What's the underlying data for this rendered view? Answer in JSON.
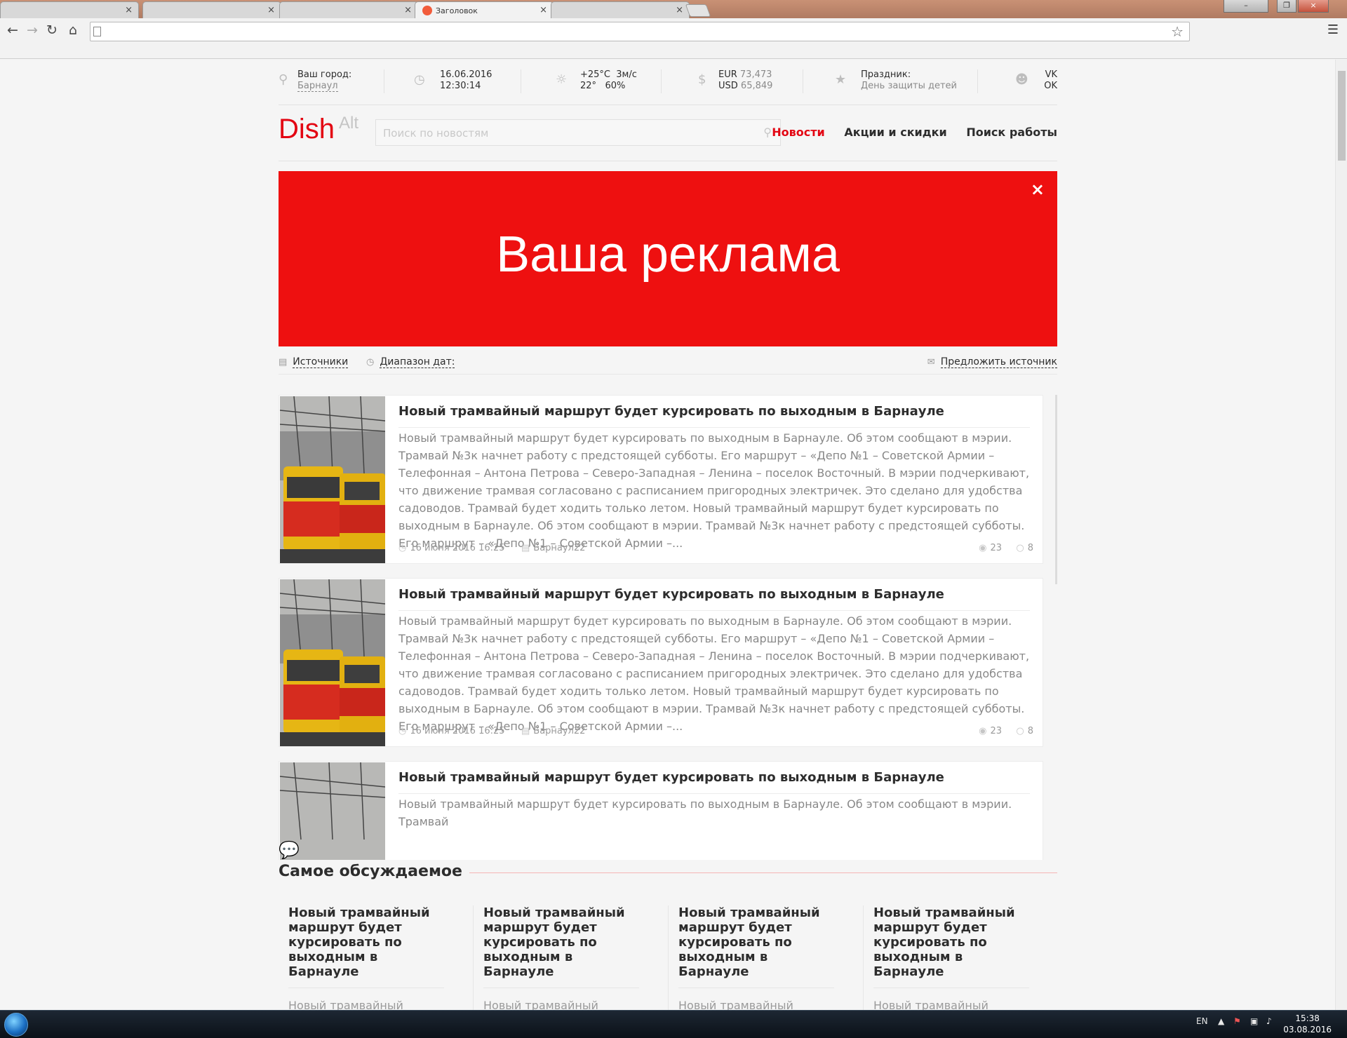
{
  "browser": {
    "tabs": [
      {
        "label": "",
        "active": false
      },
      {
        "label": "",
        "active": false
      },
      {
        "label": "",
        "active": false
      },
      {
        "label": "Заголовок",
        "active": true
      },
      {
        "label": "",
        "active": false
      }
    ],
    "tab_close": "×",
    "address": "",
    "window_buttons": {
      "minimize": "–",
      "restore": "❐",
      "close": "×"
    },
    "icons": {
      "back": "arrow-left-icon",
      "forward": "arrow-right-icon",
      "reload": "reload-icon",
      "home": "home-icon",
      "bookmark": "star-icon",
      "menu": "hamburger-icon"
    }
  },
  "topbar": {
    "city_label": "Ваш город:",
    "city_value": "Барнаул",
    "date": "16.06.2016",
    "time": "12:30:14",
    "weather_temp_day": "+25°C",
    "weather_wind": "3м/с",
    "weather_temp_night": "22°",
    "weather_humidity": "60%",
    "currency_eur_label": "EUR",
    "currency_eur_value": "73,473",
    "currency_usd_label": "USD",
    "currency_usd_value": "65,849",
    "holiday_label": "Праздник:",
    "holiday_value": "День защиты детей",
    "social_vk": "VK",
    "social_ok": "OK"
  },
  "header": {
    "logo_main": "Dish",
    "logo_alt": "Alt",
    "search_placeholder": "Поиск по новостям",
    "nav": [
      {
        "label": "Новости",
        "active": true
      },
      {
        "label": "Акции и скидки",
        "active": false
      },
      {
        "label": "Поиск работы",
        "active": false
      }
    ]
  },
  "banner": {
    "text": "Ваша реклама",
    "close": "×",
    "color": "#ee1010"
  },
  "filters": {
    "sources": "Источники",
    "date_range": "Диапазон дат:",
    "suggest": "Предложить источник"
  },
  "news": [
    {
      "title": "Новый трамвайный маршрут будет курсировать по выходным в Барнауле",
      "excerpt": "Новый трамвайный маршрут будет курсировать по выходным в Барнауле. Об этом сообщают в мэрии. Трамвай №3к начнет работу с предстоящей субботы. Его маршрут – «Депо №1 – Советской Армии – Телефонная – Антона Петрова – Северо-Западная – Ленина – поселок Восточный. В мэрии подчеркивают, что движение трамвая согласовано с расписанием пригородных электричек. Это сделано для удобства садоводов. Трамвай будет ходить только летом. Новый трамвайный маршрут будет курсировать по выходным в Барнауле. Об этом сообщают в мэрии. Трамвай №3к начнет работу с предстоящей субботы. Его маршрут – «Депо №1 – Советской Армии –...",
      "date": "16 июня 2016 16:25",
      "source": "Барнаул22",
      "views": "23",
      "comments": "8"
    },
    {
      "title": "Новый трамвайный маршрут будет курсировать по выходным в Барнауле",
      "excerpt": "Новый трамвайный маршрут будет курсировать по выходным в Барнауле. Об этом сообщают в мэрии. Трамвай №3к начнет работу с предстоящей субботы. Его маршрут – «Депо №1 – Советской Армии – Телефонная – Антона Петрова – Северо-Западная – Ленина – поселок Восточный. В мэрии подчеркивают, что движение трамвая согласовано с расписанием пригородных электричек. Это сделано для удобства садоводов. Трамвай будет ходить только летом. Новый трамвайный маршрут будет курсировать по выходным в Барнауле. Об этом сообщают в мэрии. Трамвай №3к начнет работу с предстоящей субботы. Его маршрут – «Депо №1 – Советской Армии –...",
      "date": "16 июня 2016 16:25",
      "source": "Барнаул22",
      "views": "23",
      "comments": "8"
    },
    {
      "title": "Новый трамвайный маршрут будет курсировать по выходным в Барнауле",
      "excerpt": "Новый трамвайный маршрут будет курсировать по выходным в Барнауле. Об этом сообщают в мэрии. Трамвай",
      "date": "",
      "source": "",
      "views": "",
      "comments": ""
    }
  ],
  "discussed": {
    "title": "Самое обсуждаемое",
    "items": [
      {
        "title": "Новый трамвайный маршрут будет курсировать по выходным в Барнауле",
        "excerpt": "Новый трамвайный маршрут будет курсировать по"
      },
      {
        "title": "Новый трамвайный маршрут будет курсировать по выходным в Барнауле",
        "excerpt": "Новый трамвайный маршрут будет курсировать по"
      },
      {
        "title": "Новый трамвайный маршрут будет курсировать по выходным в Барнауле",
        "excerpt": "Новый трамвайный маршрут будет курсировать по"
      },
      {
        "title": "Новый трамвайный маршрут будет курсировать по выходным в Барнауле",
        "excerpt": "Новый трамвайный маршрут будет курсировать по"
      }
    ]
  },
  "taskbar": {
    "language": "EN",
    "time": "15:38",
    "date": "03.08.2016"
  },
  "colors": {
    "accent": "#e30613",
    "banner": "#ee1010"
  }
}
